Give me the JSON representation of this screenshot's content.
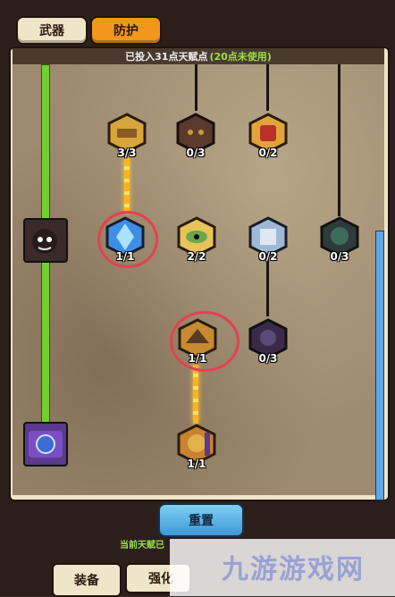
{
  "tabs": [
    {
      "label": "武器",
      "active": false
    },
    {
      "label": "防护",
      "active": true
    }
  ],
  "header": {
    "prefix": "已投入31点天赋点",
    "unused": "(20点未使用)"
  },
  "talents": {
    "row1": [
      {
        "name": "talent-gold-hammer",
        "count": "3/3",
        "color": "#d8a43c"
      },
      {
        "name": "talent-dark-mask",
        "count": "0/3",
        "color": "#5a3a2a"
      },
      {
        "name": "talent-gold-fist",
        "count": "0/2",
        "color": "#e1a43a"
      }
    ],
    "row2": [
      {
        "name": "talent-blue-crystal",
        "count": "1/1",
        "color": "#3d8ee6"
      },
      {
        "name": "talent-green-eye",
        "count": "2/2",
        "color": "#6aa64a"
      },
      {
        "name": "talent-silver-armor",
        "count": "0/2",
        "color": "#9fb8d6"
      },
      {
        "name": "talent-dark-face",
        "count": "0/3",
        "color": "#2f3b3b"
      }
    ],
    "row3": [
      {
        "name": "talent-gold-wing",
        "count": "1/1",
        "color": "#c58a32"
      },
      {
        "name": "talent-purple-shadow",
        "count": "0/3",
        "color": "#3a2a4a"
      }
    ],
    "row4": [
      {
        "name": "talent-lion-head",
        "count": "1/1",
        "color": "#c9822f"
      }
    ]
  },
  "reset_label": "重置",
  "status_text": "当前天赋已",
  "bottom_tabs": {
    "equip": "装备",
    "strength": "强化"
  },
  "watermark_text": "九游游戏网"
}
